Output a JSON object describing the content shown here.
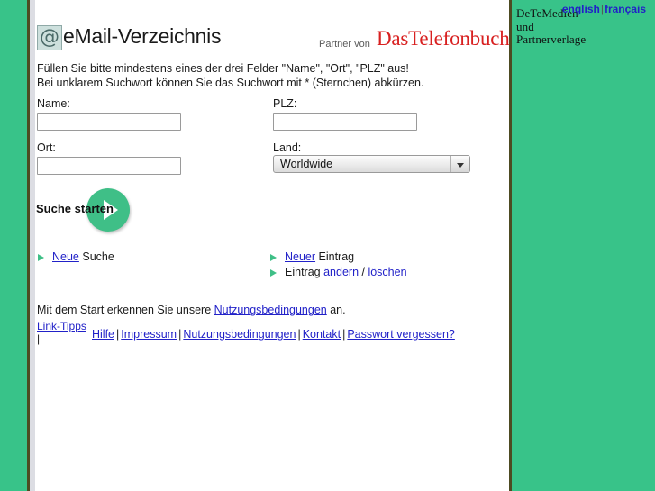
{
  "brand": {
    "sidebar_line1": "DeTeMedien",
    "sidebar_line2": "und",
    "sidebar_line3": "Partnerverlage"
  },
  "lang_bar": {
    "english": "english",
    "separator": "|",
    "francais": "français"
  },
  "header": {
    "logo_glyph": "@",
    "site_title": "eMail-Verzeichnis",
    "partner_label": "Partner von",
    "partner_logo": "DasTelefonbuch"
  },
  "instructions": {
    "line1": "Füllen Sie bitte mindestens eines der drei Felder \"Name\", \"Ort\", \"PLZ\" aus!",
    "line2": "Bei unklarem Suchwort können Sie das Suchwort mit * (Sternchen) abkürzen."
  },
  "form": {
    "name_label": "Name:",
    "name_value": "",
    "name_placeholder": "",
    "plz_label": "PLZ:",
    "plz_value": "",
    "plz_placeholder": "",
    "ort_label": "Ort:",
    "ort_value": "",
    "ort_placeholder": "",
    "land_label": "Land:",
    "land_selected": "Worldwide"
  },
  "start": {
    "label": "Suche starten",
    "circle_color": "#3fbf87"
  },
  "links": {
    "left": [
      {
        "link": "Neue",
        "rest": " Suche"
      }
    ],
    "right": [
      {
        "pre": "",
        "link": "Neuer",
        "rest": " Eintrag"
      },
      {
        "pre": "Eintrag ",
        "link": "ändern",
        "sep": " / ",
        "link2": "löschen",
        "rest": ""
      }
    ]
  },
  "footer": {
    "terms_pre": "Mit dem Start erkennen Sie unsere ",
    "terms_link": "Nutzungsbedingungen",
    "terms_post": " an.",
    "link_tipps": "Link-Tipps",
    "link_tipps_pipe": "|",
    "nav": [
      "Hilfe",
      "Impressum",
      "Nutzungsbedingungen",
      "Kontakt",
      "Passwort vergessen?"
    ],
    "nav_sep": "|"
  },
  "colors": {
    "page_green": "#38c389",
    "border_olive": "#4d4b22",
    "link_blue": "#2121c8",
    "brand_red": "#d82020",
    "accent_green": "#3fbf87"
  }
}
